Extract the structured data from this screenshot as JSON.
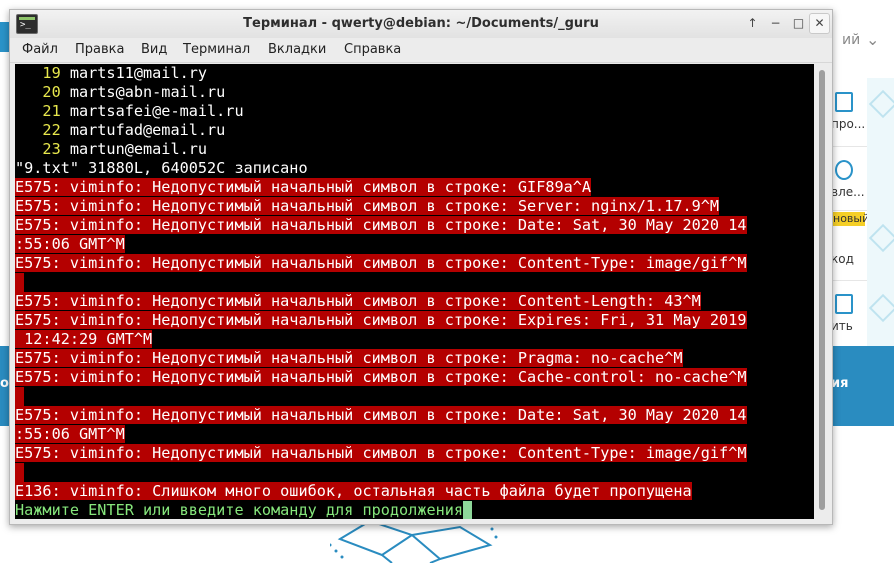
{
  "background": {
    "lang_suffix": "ий",
    "sidebar_labels": [
      "про...",
      "вле...",
      "код",
      "ить"
    ],
    "badge": "новый",
    "banner_right": "ия",
    "banner_left": "от"
  },
  "window": {
    "title": "Терминал - qwerty@debian: ~/Documents/_guru",
    "controls": [
      "↑",
      "−",
      "□",
      "✕"
    ]
  },
  "menu": [
    "Файл",
    "Правка",
    "Вид",
    "Терминал",
    "Вкладки",
    "Справка"
  ],
  "terminal": {
    "lines": [
      {
        "num": "   19",
        "text": " marts11@mail.ry",
        "kind": "numbered"
      },
      {
        "num": "   20",
        "text": " marts@abn-mail.ru",
        "kind": "numbered"
      },
      {
        "num": "   21",
        "text": " martsafei@e-mail.ru",
        "kind": "numbered"
      },
      {
        "num": "   22",
        "text": " martufad@email.ru",
        "kind": "numbered"
      },
      {
        "num": "   23",
        "text": " martun@email.ru",
        "kind": "numbered"
      },
      {
        "num": "",
        "text": "\"9.txt\" 31880L, 640052C записано",
        "kind": "plain"
      },
      {
        "num": "",
        "text": "E575: viminfo: Недопустимый начальный символ в строке: GIF89a^A",
        "kind": "error"
      },
      {
        "num": "",
        "text": "E575: viminfo: Недопустимый начальный символ в строке: Server: nginx/1.17.9^M",
        "kind": "error"
      },
      {
        "num": "",
        "text": "E575: viminfo: Недопустимый начальный символ в строке: Date: Sat, 30 May 2020 14",
        "kind": "error"
      },
      {
        "num": "",
        "text": ":55:06 GMT^M",
        "kind": "error"
      },
      {
        "num": "",
        "text": "E575: viminfo: Недопустимый начальный символ в строке: Content-Type: image/gif^M",
        "kind": "error"
      },
      {
        "num": "",
        "text": "",
        "kind": "errblank"
      },
      {
        "num": "",
        "text": "E575: viminfo: Недопустимый начальный символ в строке: Content-Length: 43^M",
        "kind": "error"
      },
      {
        "num": "",
        "text": "E575: viminfo: Недопустимый начальный символ в строке: Expires: Fri, 31 May 2019",
        "kind": "error"
      },
      {
        "num": "",
        "text": " 12:42:29 GMT^M",
        "kind": "error"
      },
      {
        "num": "",
        "text": "E575: viminfo: Недопустимый начальный символ в строке: Pragma: no-cache^M",
        "kind": "error"
      },
      {
        "num": "",
        "text": "E575: viminfo: Недопустимый начальный символ в строке: Cache-control: no-cache^M",
        "kind": "error"
      },
      {
        "num": "",
        "text": "",
        "kind": "errblank"
      },
      {
        "num": "",
        "text": "E575: viminfo: Недопустимый начальный символ в строке: Date: Sat, 30 May 2020 14",
        "kind": "error"
      },
      {
        "num": "",
        "text": ":55:06 GMT^M",
        "kind": "error"
      },
      {
        "num": "",
        "text": "E575: viminfo: Недопустимый начальный символ в строке: Content-Type: image/gif^M",
        "kind": "error"
      },
      {
        "num": "",
        "text": "",
        "kind": "errblank"
      },
      {
        "num": "",
        "text": "E136: viminfo: Слишком много ошибок, остальная часть файла будет пропущена",
        "kind": "error"
      },
      {
        "num": "",
        "text": "Нажмите ENTER или введите команду для продолжения",
        "kind": "prompt"
      }
    ]
  },
  "colors": {
    "error_bg": "#b40000",
    "line_number": "#e8e84d",
    "prompt": "#86e67c",
    "terminal_bg": "#000000",
    "accent": "#2a8cc0"
  }
}
